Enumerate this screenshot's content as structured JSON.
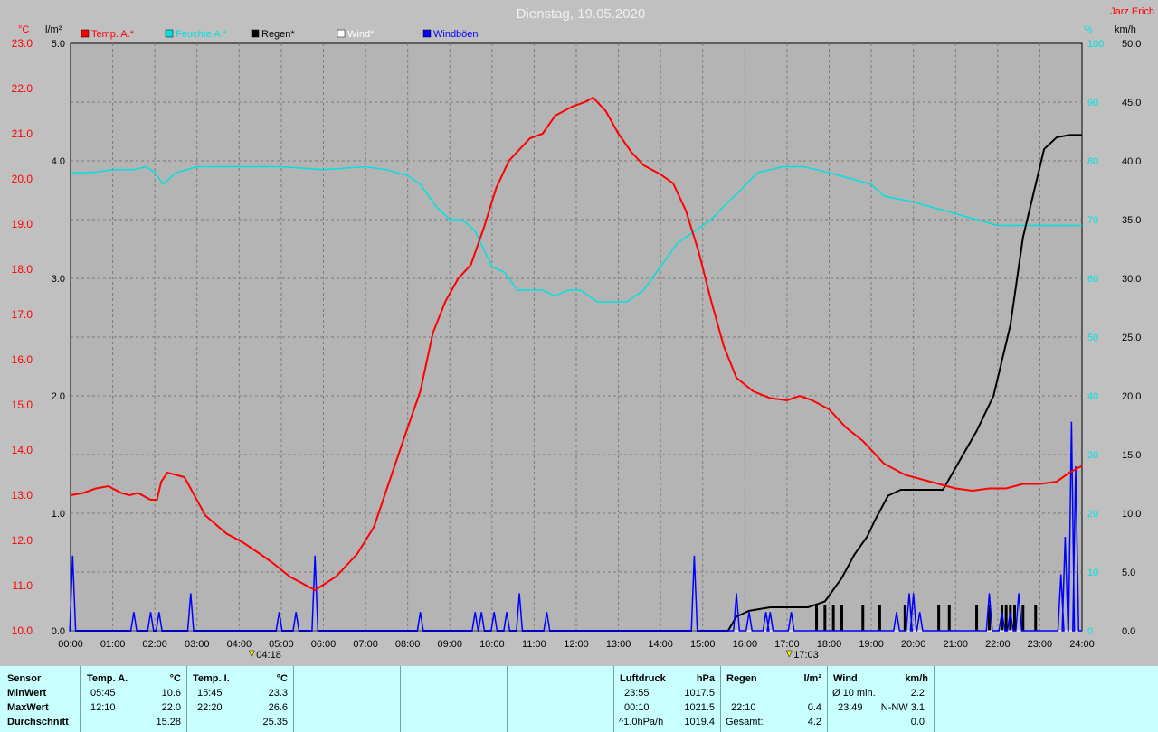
{
  "colors": {
    "background": "#c0c0c0",
    "plot": "#b4b4b4",
    "temp": "#ff0000",
    "humidity": "#00e0e0",
    "rain": "#000000",
    "wind": "#ffffff",
    "gust": "#0000ff",
    "stat_panel": "#c8ffff"
  },
  "chart_data": {
    "type": "line",
    "title": "Dienstag, 19.05.2020",
    "author": "Jarz Erich",
    "legend": [
      {
        "name": "Temp. A.*",
        "color": "#ff0000"
      },
      {
        "name": "Feuchte A.*",
        "color": "#00e0e0"
      },
      {
        "name": "Regen*",
        "color": "#000000"
      },
      {
        "name": "Wind*",
        "color": "#ffffff"
      },
      {
        "name": "Windböen",
        "color": "#0000ff"
      }
    ],
    "axes": {
      "left1": {
        "unit": "°C",
        "min": 10,
        "max": 23,
        "ticks": [
          "10.0",
          "11.0",
          "12.0",
          "13.0",
          "14.0",
          "15.0",
          "16.0",
          "17.0",
          "18.0",
          "19.0",
          "20.0",
          "21.0",
          "22.0",
          "23.0"
        ]
      },
      "left2": {
        "unit": "l/m²",
        "min": 0,
        "max": 5,
        "ticks": [
          "0.0",
          "1.0",
          "2.0",
          "3.0",
          "4.0",
          "5.0"
        ]
      },
      "right1": {
        "unit": "%",
        "min": 0,
        "max": 100,
        "ticks": [
          "0",
          "10",
          "20",
          "30",
          "40",
          "50",
          "60",
          "70",
          "80",
          "90",
          "100"
        ]
      },
      "right2": {
        "unit": "km/h",
        "min": 0,
        "max": 50,
        "ticks": [
          "0.0",
          "5.0",
          "10.0",
          "15.0",
          "20.0",
          "25.0",
          "30.0",
          "35.0",
          "40.0",
          "45.0",
          "50.0"
        ]
      },
      "x": {
        "ticks": [
          "00:00",
          "01:00",
          "02:00",
          "03:00",
          "04:00",
          "05:00",
          "06:00",
          "07:00",
          "08:00",
          "09:00",
          "10:00",
          "11:00",
          "12:00",
          "13:00",
          "14:00",
          "15:00",
          "16:00",
          "17:00",
          "18:00",
          "19:00",
          "20:00",
          "21:00",
          "22:00",
          "23:00",
          "24:00"
        ]
      }
    },
    "sunrise": "04:18",
    "sunset": "17:03",
    "grid": true,
    "series": [
      {
        "name": "Temp. A.*",
        "x_hours": [
          0,
          0.3,
          0.6,
          0.9,
          1.2,
          1.4,
          1.6,
          1.9,
          2.05,
          2.15,
          2.3,
          2.7,
          3.2,
          3.7,
          4.1,
          4.5,
          4.8,
          5.2,
          5.5,
          5.8,
          6.3,
          6.8,
          7.2,
          7.6,
          8,
          8.3,
          8.6,
          8.9,
          9.2,
          9.5,
          9.8,
          10.1,
          10.4,
          10.6,
          10.9,
          11.2,
          11.5,
          11.9,
          12.2,
          12.4,
          12.7,
          13,
          13.3,
          13.6,
          14,
          14.3,
          14.6,
          14.9,
          15.2,
          15.5,
          15.8,
          16.2,
          16.6,
          17,
          17.3,
          17.6,
          18,
          18.4,
          18.8,
          19.3,
          19.8,
          20.2,
          20.6,
          21,
          21.4,
          21.8,
          22.2,
          22.6,
          23,
          23.4,
          23.7,
          24
        ],
        "values": [
          13,
          13.05,
          13.15,
          13.2,
          13.05,
          13,
          13.05,
          12.9,
          12.9,
          13.3,
          13.5,
          13.4,
          12.55,
          12.15,
          11.95,
          11.7,
          11.5,
          11.2,
          11.05,
          10.9,
          11.2,
          11.7,
          12.3,
          13.4,
          14.5,
          15.3,
          16.6,
          17.3,
          17.8,
          18.1,
          18.9,
          19.8,
          20.4,
          20.6,
          20.9,
          21,
          21.4,
          21.6,
          21.7,
          21.8,
          21.5,
          21,
          20.6,
          20.3,
          20.1,
          19.9,
          19.3,
          18.4,
          17.3,
          16.3,
          15.6,
          15.3,
          15.15,
          15.1,
          15.2,
          15.1,
          14.9,
          14.5,
          14.2,
          13.7,
          13.45,
          13.35,
          13.25,
          13.15,
          13.1,
          13.15,
          13.15,
          13.25,
          13.25,
          13.3,
          13.5,
          13.65
        ]
      },
      {
        "name": "Feuchte A.*",
        "x_hours": [
          0,
          0.5,
          1,
          1.5,
          1.8,
          2,
          2.2,
          2.5,
          3,
          4,
          5,
          6,
          7,
          7.5,
          8,
          8.3,
          8.7,
          9,
          9.3,
          9.6,
          10,
          10.3,
          10.6,
          10.9,
          11.2,
          11.5,
          11.8,
          12.1,
          12.5,
          12.9,
          13.2,
          13.6,
          14,
          14.4,
          14.8,
          15.2,
          15.6,
          15.9,
          16.3,
          16.9,
          17.4,
          18,
          18.5,
          19,
          19.3,
          20,
          20.5,
          21,
          21.5,
          22,
          22.5,
          23,
          23.5,
          24
        ],
        "values": [
          78,
          78,
          78.5,
          78.5,
          79,
          78,
          76,
          78,
          79,
          79,
          79,
          78.5,
          79,
          78.5,
          77.5,
          76,
          72,
          70,
          70,
          68,
          62,
          61,
          58,
          58,
          58,
          57,
          58,
          58,
          56,
          56,
          56,
          58,
          62,
          66,
          68,
          70,
          73,
          75,
          78,
          79,
          79,
          78,
          77,
          76,
          74,
          73,
          72,
          71,
          70,
          69,
          69,
          69,
          69,
          69
        ]
      },
      {
        "name": "Regen*",
        "x_hours": [
          0,
          15.6,
          15.8,
          16.1,
          16.6,
          17.5,
          17.9,
          18.3,
          18.6,
          18.9,
          19.1,
          19.4,
          19.7,
          20.2,
          20.7,
          21.1,
          21.5,
          21.9,
          22.3,
          22.6,
          22.9,
          23.1,
          23.4,
          23.7,
          24
        ],
        "values": [
          0,
          0,
          0.12,
          0.17,
          0.2,
          0.2,
          0.25,
          0.45,
          0.65,
          0.8,
          0.95,
          1.15,
          1.2,
          1.2,
          1.2,
          1.45,
          1.7,
          2,
          2.6,
          3.35,
          3.8,
          4.1,
          4.2,
          4.22,
          4.22
        ]
      },
      {
        "name": "Wind*",
        "x_hours": [
          0,
          24
        ],
        "values": [
          0,
          0
        ]
      },
      {
        "name": "Windböen",
        "peaks": [
          [
            0.05,
            6.4
          ],
          [
            1.5,
            1.6
          ],
          [
            1.9,
            1.6
          ],
          [
            2.1,
            1.6
          ],
          [
            2.85,
            3.2
          ],
          [
            4.95,
            1.6
          ],
          [
            5.35,
            1.6
          ],
          [
            5.8,
            6.4
          ],
          [
            8.3,
            1.6
          ],
          [
            9.6,
            1.6
          ],
          [
            9.75,
            1.6
          ],
          [
            10.05,
            1.6
          ],
          [
            10.35,
            1.6
          ],
          [
            10.65,
            3.2
          ],
          [
            11.3,
            1.6
          ],
          [
            14.8,
            6.4
          ],
          [
            15.8,
            3.2
          ],
          [
            16.1,
            1.6
          ],
          [
            16.5,
            1.6
          ],
          [
            16.6,
            1.6
          ],
          [
            17.1,
            1.6
          ],
          [
            19.6,
            1.6
          ],
          [
            19.9,
            3.2
          ],
          [
            20.0,
            3.2
          ],
          [
            20.15,
            1.6
          ],
          [
            21.8,
            3.2
          ],
          [
            22.1,
            1.6
          ],
          [
            22.3,
            1.6
          ],
          [
            22.5,
            3.2
          ],
          [
            23.5,
            4.8
          ],
          [
            23.6,
            8
          ],
          [
            23.75,
            17.8
          ],
          [
            23.85,
            14
          ]
        ]
      }
    ],
    "rain_events_hours": [
      17.7,
      17.9,
      18.1,
      18.3,
      18.8,
      19.2,
      19.8,
      20.6,
      20.85,
      21.5,
      21.8,
      22.1,
      22.2,
      22.3,
      22.4,
      22.6,
      22.9
    ]
  },
  "stats": {
    "sensor": {
      "header": "Sensor",
      "rows": [
        "MinWert",
        "MaxWert",
        "Durchschnitt"
      ]
    },
    "temp_a": {
      "label": "Temp. A.",
      "unit": "°C",
      "min_time": "05:45",
      "min_val": "10.6",
      "max_time": "12:10",
      "max_val": "22.0",
      "avg": "15.28"
    },
    "temp_i": {
      "label": "Temp. I.",
      "unit": "°C",
      "min_time": "15:45",
      "min_val": "23.3",
      "max_time": "22:20",
      "max_val": "26.6",
      "avg": "25.35"
    },
    "pressure": {
      "label": "Luftdruck",
      "unit": "hPa",
      "min_time": "23:55",
      "min_val": "1017.5",
      "max_time": "00:10",
      "max_val": "1021.5",
      "trend": "^1.0hPa/h",
      "trend_val": "1019.4"
    },
    "rain": {
      "label": "Regen",
      "unit": "l/m²",
      "max_time": "22:10",
      "max_val": "0.4",
      "total_label": "Gesamt:",
      "total_val": "4.2"
    },
    "wind": {
      "label": "Wind",
      "unit": "km/h",
      "avg_label": "Ø 10 min.",
      "avg_val": "2.2",
      "max_time": "23:49",
      "max_dir": "N-NW 3.1",
      "avg_day": "0.0"
    }
  }
}
